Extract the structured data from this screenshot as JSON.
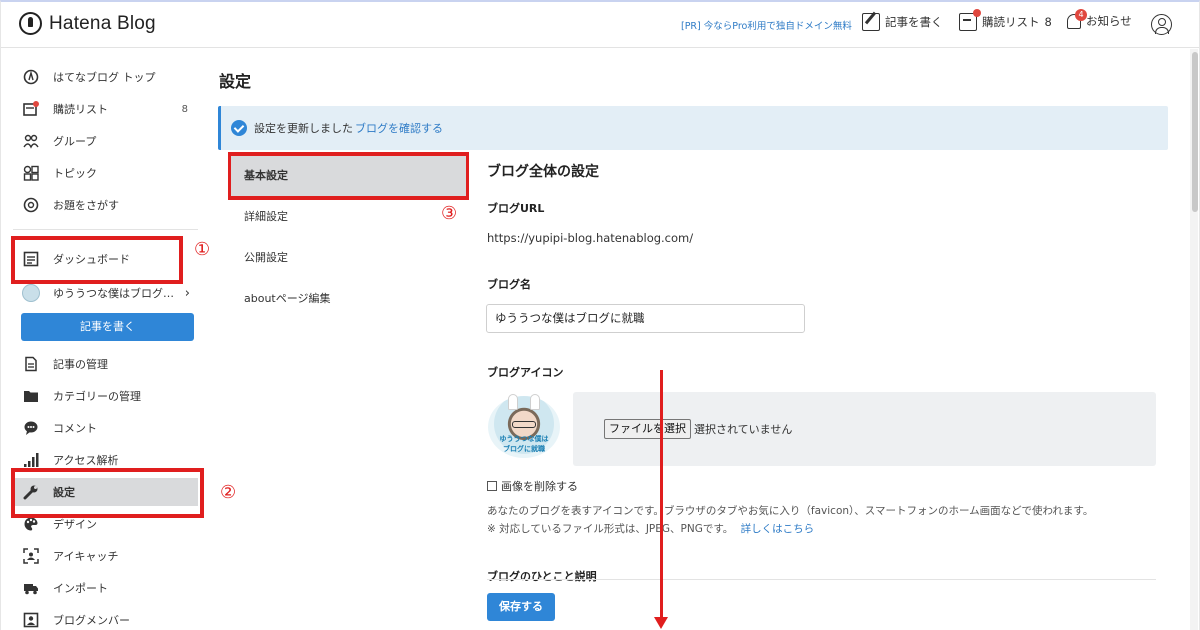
{
  "header": {
    "logo_text": "Hatena Blog",
    "pr_link": "[PR] 今ならPro利用で独自ドメイン無料",
    "write_label": "記事を書く",
    "reading_list_label": "購読リスト",
    "reading_list_count": "8",
    "notifications_label": "お知らせ",
    "notifications_badge": "4"
  },
  "sidebar": {
    "items": [
      {
        "label": "はてなブログ トップ",
        "icon": "hatena-top-icon"
      },
      {
        "label": "購読リスト",
        "icon": "reading-list-icon",
        "count": "8"
      },
      {
        "label": "グループ",
        "icon": "group-icon"
      },
      {
        "label": "トピック",
        "icon": "topic-icon"
      },
      {
        "label": "お題をさがす",
        "icon": "theme-search-icon"
      },
      {
        "label": "ダッシュボード",
        "icon": "dashboard-icon"
      },
      {
        "label": "ゆううつな僕はブログ…",
        "icon": "blog-avatar-icon"
      },
      {
        "label": "記事の管理",
        "icon": "article-manage-icon"
      },
      {
        "label": "カテゴリーの管理",
        "icon": "folder-icon"
      },
      {
        "label": "コメント",
        "icon": "comment-icon"
      },
      {
        "label": "アクセス解析",
        "icon": "analytics-icon"
      },
      {
        "label": "設定",
        "icon": "wrench-icon"
      },
      {
        "label": "デザイン",
        "icon": "palette-icon"
      },
      {
        "label": "アイキャッチ",
        "icon": "eyecatch-icon"
      },
      {
        "label": "インポート",
        "icon": "truck-icon"
      },
      {
        "label": "ブログメンバー",
        "icon": "member-icon"
      }
    ],
    "write_button": "記事を書く"
  },
  "annotations": {
    "mark1": "①",
    "mark2": "②",
    "mark3": "③",
    "color": "#e01e1e"
  },
  "main": {
    "page_title": "設定",
    "notice_text": "設定を更新しました",
    "notice_link": "ブログを確認する",
    "subnav": [
      "基本設定",
      "詳細設定",
      "公開設定",
      "aboutページ編集"
    ],
    "section_title": "ブログ全体の設定",
    "blog_url_label": "ブログURL",
    "blog_url_value": "https://yupipi-blog.hatenablog.com/",
    "blog_name_label": "ブログ名",
    "blog_name_value": "ゆううつな僕はブログに就職",
    "blog_icon_label": "ブログアイコン",
    "blog_icon_caption": "ゆううつな僕は ブログに就職",
    "file_button": "ファイルを選択",
    "file_status": "選択されていません",
    "delete_image_label": "画像を削除する",
    "help_1": "あなたのブログを表すアイコンです。ブラウザのタブやお気に入り（favicon）、スマートフォンのホーム画面などで使われます。",
    "help_2": "※ 対応しているファイル形式は、JPEG、PNGです。",
    "help_link": "詳しくはこちら",
    "next_section_label": "ブログのひとこと説明",
    "save_button": "保存する"
  },
  "colors": {
    "accent": "#2f86d7",
    "active_bg": "#d9dadc",
    "notice_bg": "#e3eef6"
  }
}
